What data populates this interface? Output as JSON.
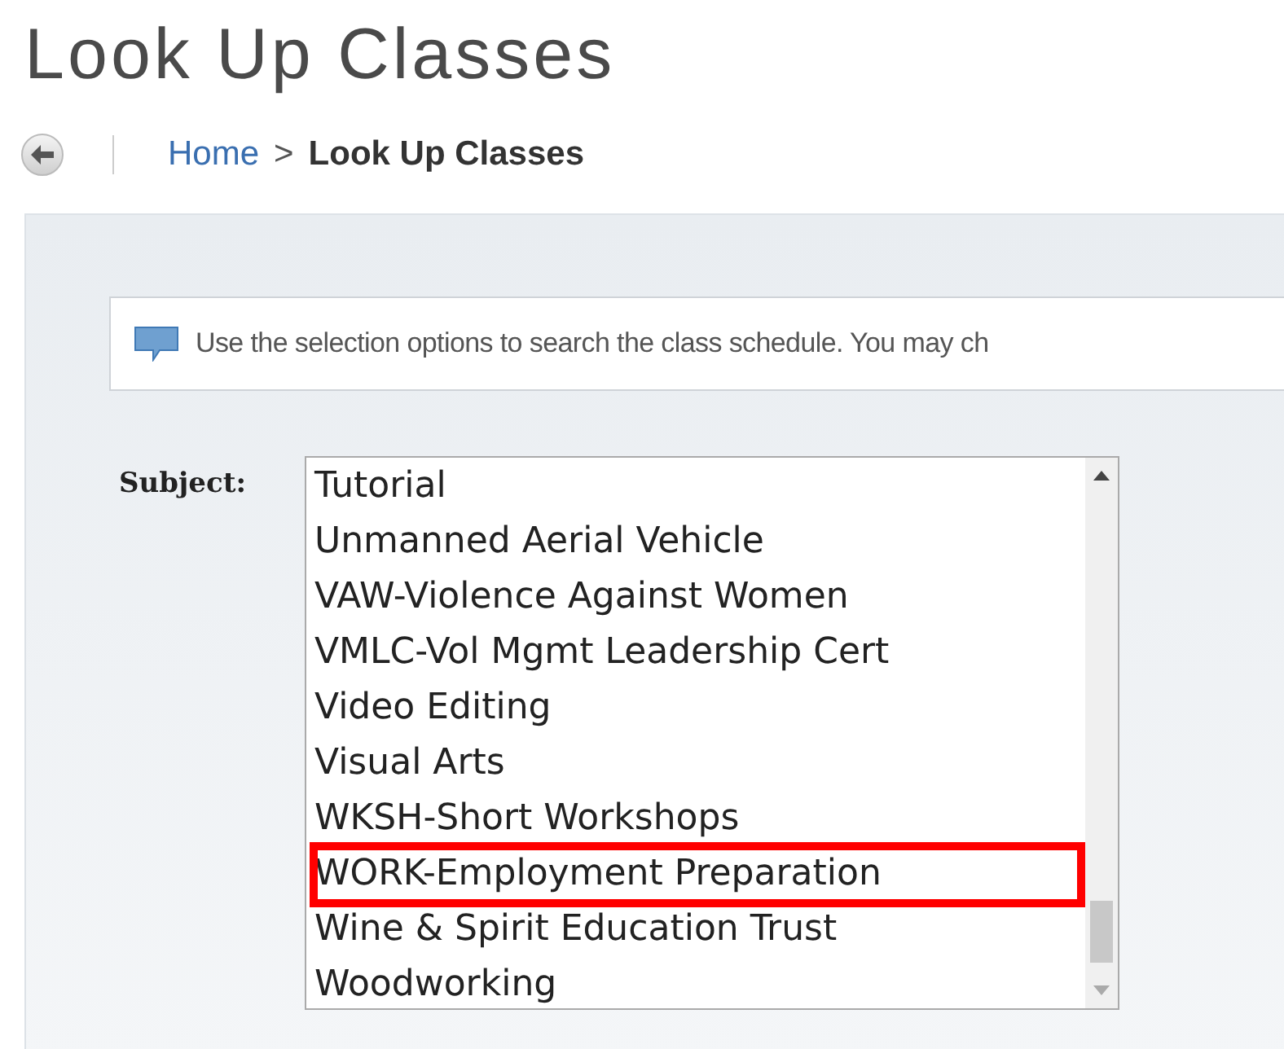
{
  "page_title": "Look Up Classes",
  "breadcrumb": {
    "home": "Home",
    "separator": ">",
    "current": "Look Up Classes"
  },
  "info_message": "Use the selection options to search the class schedule. You may ch",
  "subject": {
    "label": "Subject:",
    "options": [
      {
        "label": "Tutorial",
        "highlighted": false
      },
      {
        "label": "Unmanned Aerial Vehicle",
        "highlighted": false
      },
      {
        "label": "VAW-Violence Against Women",
        "highlighted": false
      },
      {
        "label": "VMLC-Vol Mgmt Leadership Cert",
        "highlighted": false
      },
      {
        "label": "Video Editing",
        "highlighted": false
      },
      {
        "label": "Visual Arts",
        "highlighted": false
      },
      {
        "label": "WKSH-Short Workshops",
        "highlighted": false
      },
      {
        "label": "WORK-Employment Preparation",
        "highlighted": true
      },
      {
        "label": "Wine & Spirit Education Trust",
        "highlighted": false
      },
      {
        "label": "Woodworking",
        "highlighted": false
      }
    ]
  }
}
